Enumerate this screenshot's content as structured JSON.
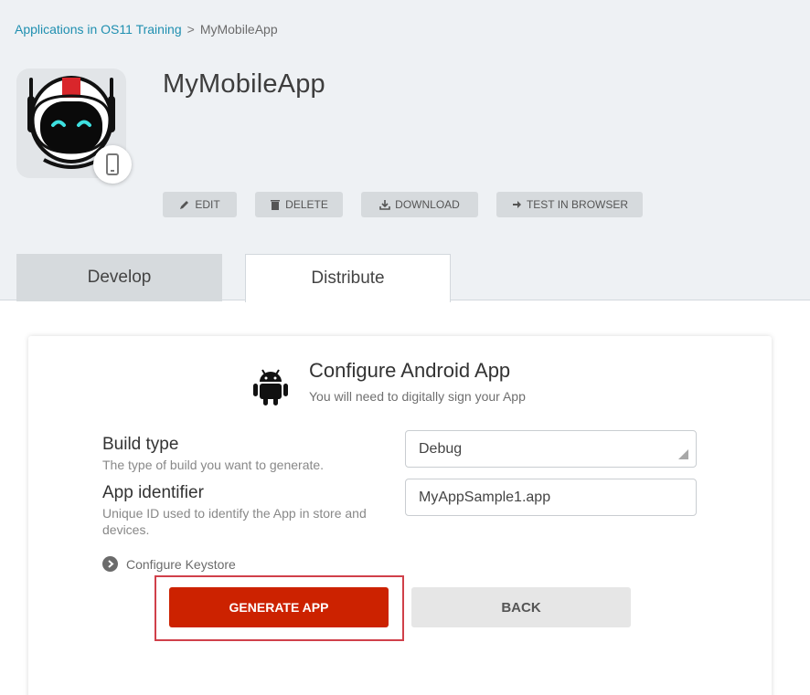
{
  "breadcrumb": {
    "parent": "Applications in OS11 Training",
    "separator": ">",
    "current": "MyMobileApp"
  },
  "app": {
    "title": "MyMobileApp",
    "icon": "robot-astronaut-icon",
    "device_badge_icon": "mobile-phone-icon"
  },
  "actions": {
    "edit": "EDIT",
    "delete": "DELETE",
    "download": "DOWNLOAD",
    "test": "TEST IN BROWSER"
  },
  "tabs": [
    {
      "label": "Develop",
      "active": false
    },
    {
      "label": "Distribute",
      "active": true
    }
  ],
  "config": {
    "title": "Configure Android App",
    "subtitle": "You will need to digitally sign your App",
    "icon": "android-icon"
  },
  "fields": {
    "build_type": {
      "label": "Build type",
      "help": "The type of build you want to generate.",
      "value": "Debug"
    },
    "app_identifier": {
      "label": "App identifier",
      "help": "Unique ID used to identify the App in store and devices.",
      "value": "MyAppSample1.app"
    }
  },
  "keystore": {
    "label": "Configure Keystore"
  },
  "buttons": {
    "generate": "GENERATE APP",
    "back": "BACK"
  },
  "colors": {
    "link": "#1f8fb0",
    "primary": "#cc2200",
    "highlight": "#d0404a",
    "header_bg": "#eef1f4"
  }
}
